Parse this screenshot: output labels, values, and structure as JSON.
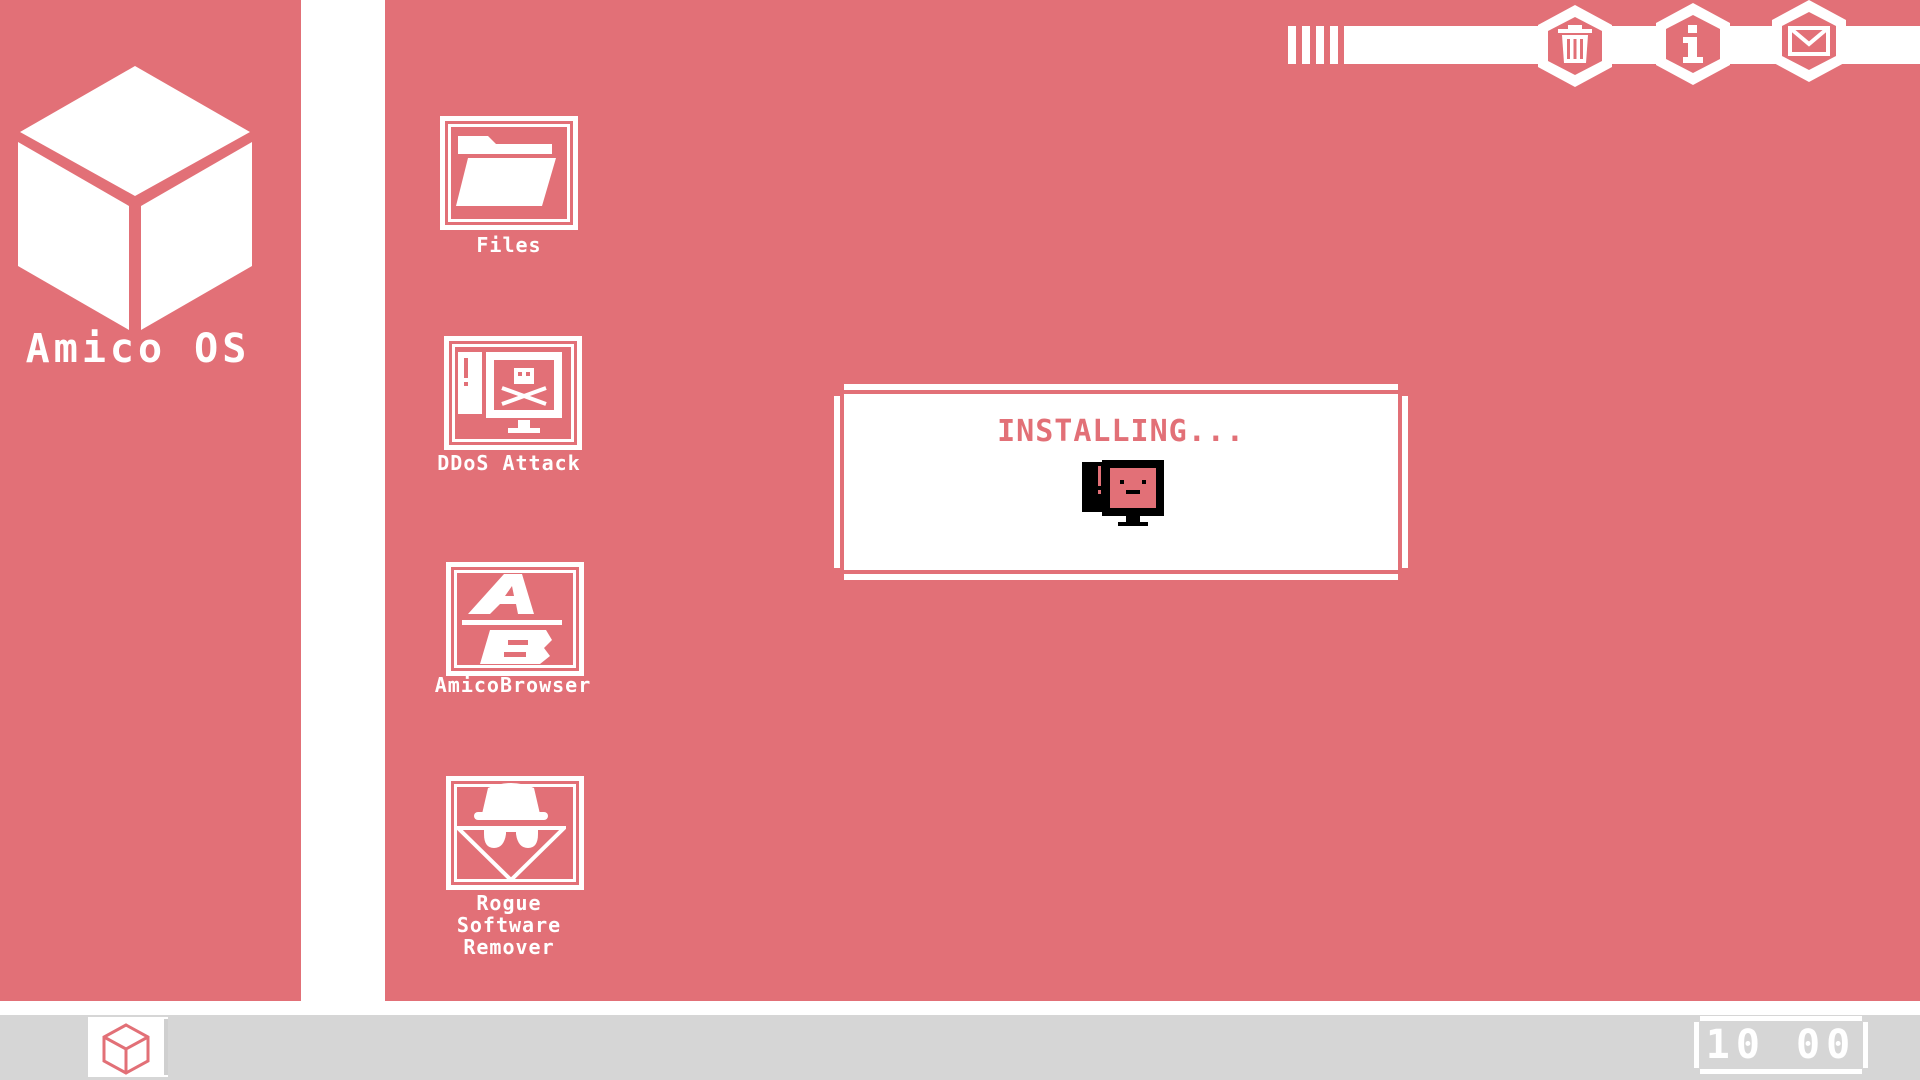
{
  "brand": {
    "name": "Amico OS"
  },
  "desktop": {
    "icons": [
      {
        "label": "Files",
        "icon": "folder-icon"
      },
      {
        "label": "DDoS Attack",
        "icon": "skull-computer-icon"
      },
      {
        "label": "AmicoBrowser",
        "icon": "browser-ab-icon"
      },
      {
        "label_lines": [
          "Rogue",
          "Software",
          "Remover"
        ],
        "icon": "spy-icon"
      }
    ]
  },
  "topbar": {
    "buttons": [
      {
        "icon": "trash-icon"
      },
      {
        "icon": "info-icon"
      },
      {
        "icon": "mail-icon"
      }
    ]
  },
  "dialog": {
    "title": "INSTALLING..."
  },
  "taskbar": {
    "start_icon": "cube-icon",
    "clock": "10 00"
  },
  "colors": {
    "accent": "#e27077",
    "white": "#ffffff",
    "taskbar": "#d6d6d6"
  }
}
